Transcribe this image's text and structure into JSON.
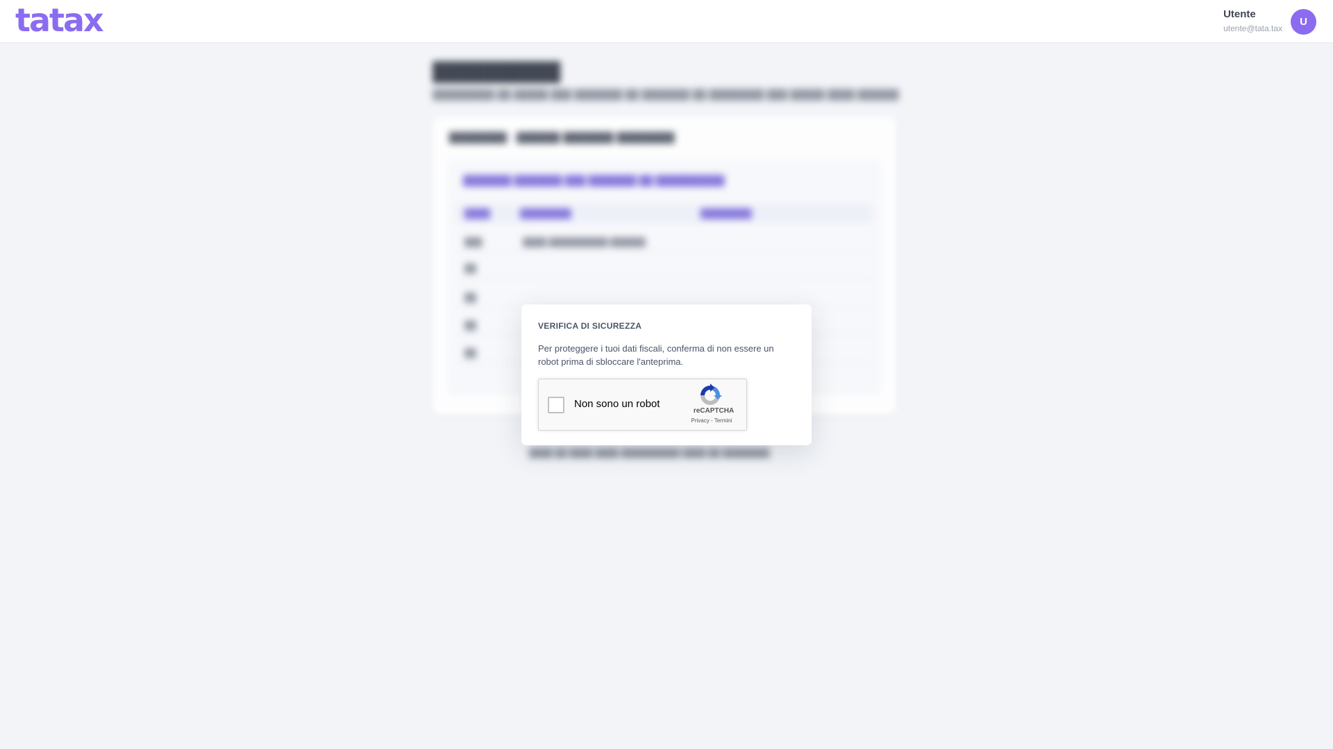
{
  "header": {
    "logo_text": "tatax",
    "user_name": "Utente",
    "user_email": "utente@tata.tax",
    "avatar_initial": "U"
  },
  "colors": {
    "brand": "#8b6cf0",
    "background": "#f2f4f8",
    "modal_text": "#4a5568"
  },
  "modal": {
    "title": "VERIFICA DI SICUREZZA",
    "text": "Per proteggere i tuoi dati fiscali, conferma di non essere un robot prima di sbloccare l'anteprima.",
    "recaptcha": {
      "checkbox_label": "Non sono un robot",
      "checked": false,
      "brand": "reCAPTCHA",
      "privacy_link": "Privacy",
      "separator": " - ",
      "terms_link": "Termini",
      "logo_icon": "recaptcha-logo-icon"
    }
  }
}
